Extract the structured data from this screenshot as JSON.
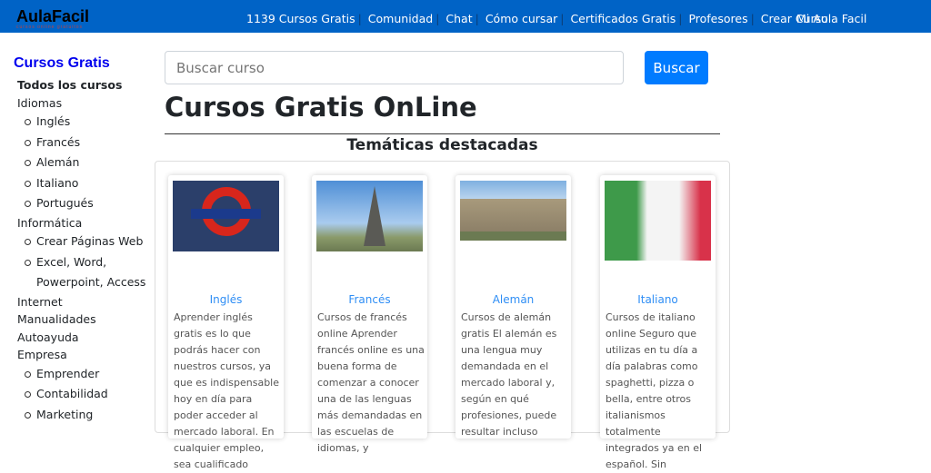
{
  "header": {
    "logo": "AulaFacil",
    "logo_tagline": "cursos online gratuitos",
    "nav": [
      "1139 Cursos Gratis",
      "Comunidad",
      "Chat",
      "Cómo cursar",
      "Certificados Gratis",
      "Profesores",
      "Crear Curso"
    ],
    "account": "Mi Aula Facil"
  },
  "sidebar": {
    "title": "Cursos Gratis",
    "items": [
      {
        "label": "Todos los cursos",
        "level": 0,
        "bold": true
      },
      {
        "label": "Idiomas",
        "level": 0
      },
      {
        "label": "Inglés",
        "level": 1
      },
      {
        "label": "Francés",
        "level": 1
      },
      {
        "label": "Alemán",
        "level": 1
      },
      {
        "label": "Italiano",
        "level": 1
      },
      {
        "label": "Portugués",
        "level": 1
      },
      {
        "label": "Informática",
        "level": 0
      },
      {
        "label": "Crear Páginas Web",
        "level": 1
      },
      {
        "label": "Excel, Word,",
        "level": 1
      },
      {
        "label": "Powerpoint, Access",
        "level": 1,
        "cont": true
      },
      {
        "label": "Internet",
        "level": 0
      },
      {
        "label": "Manualidades",
        "level": 0
      },
      {
        "label": "Autoayuda",
        "level": 0
      },
      {
        "label": "Empresa",
        "level": 0
      },
      {
        "label": "Emprender",
        "level": 1
      },
      {
        "label": "Contabilidad",
        "level": 1
      },
      {
        "label": "Marketing",
        "level": 1
      }
    ]
  },
  "search": {
    "placeholder": "Buscar curso",
    "button": "Buscar"
  },
  "main": {
    "title": "Cursos Gratis OnLine",
    "section": "Temáticas destacadas",
    "cards": [
      {
        "title": "Inglés",
        "text": "Aprender inglés gratis es lo que podrás hacer con nuestros cursos, ya que es indispensable hoy en día para poder acceder al mercado laboral. En cualquier empleo, sea cualificado",
        "image": "london-underground-sign"
      },
      {
        "title": "Francés",
        "text": "Cursos de francés online Aprender francés online es una buena forma de comenzar a conocer una de las lenguas más demandadas en las escuelas de idiomas, y",
        "image": "eiffel-tower"
      },
      {
        "title": "Alemán",
        "text": "Cursos de alemán gratis El alemán es una lengua muy demandada en el mercado laboral y, según en qué profesiones, puede resultar incluso",
        "image": "reichstag-building"
      },
      {
        "title": "Italiano",
        "text": "Cursos de italiano online Seguro que utilizas en tu día a día palabras como spaghetti, pizza o bella, entre otros italianismos totalmente integrados ya en el español. Sin",
        "image": "italian-flag-hand"
      }
    ]
  }
}
